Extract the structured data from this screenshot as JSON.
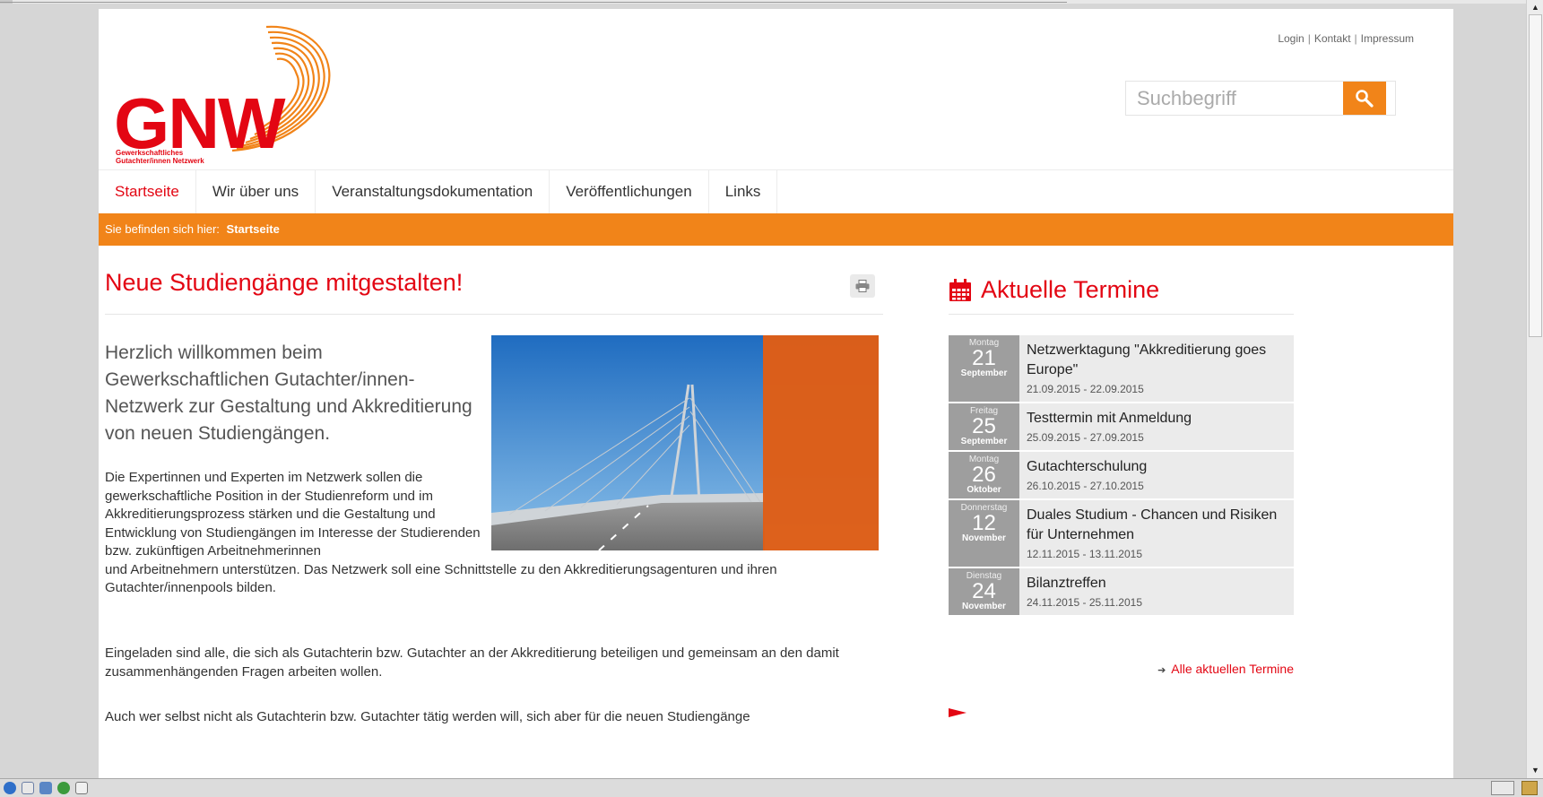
{
  "header": {
    "logo_text": "GNW",
    "logo_subtitle_line1": "Gewerkschaftliches",
    "logo_subtitle_line2": "Gutachter/innen Netzwerk",
    "utility_links": [
      "Login",
      "Kontakt",
      "Impressum"
    ],
    "search_placeholder": "Suchbegriff"
  },
  "nav": {
    "items": [
      "Startseite",
      "Wir über uns",
      "Veranstaltungsdokumentation",
      "Veröffentlichungen",
      "Links"
    ],
    "active": "Startseite"
  },
  "breadcrumb": {
    "prefix": "Sie befinden sich hier:",
    "current": "Startseite"
  },
  "main": {
    "title": "Neue Studiengänge mitgestalten!",
    "lead": "Herzlich willkommen beim Gewerkschaftlichen Gutachter/innen-Netzwerk zur Gestaltung und Akkreditierung von neuen Studiengängen.",
    "para1_a": "Die Expertinnen und Experten im Netzwerk sollen die gewerkschaftliche Position in der Studienreform und im Akkreditierungsprozess stärken und die Gestaltung und Entwicklung von Studiengängen im Interesse der Studierenden bzw. zukünftigen Arbeitnehmerinnen",
    "para1_b": "und Arbeitnehmern unterstützen. Das Netzwerk soll eine Schnittstelle zu den Akkreditierungsagenturen und ihren Gutachter/innenpools bilden.",
    "para2": "Eingeladen sind alle, die sich als Gutachterin bzw. Gutachter an der Akkreditierung beteiligen und gemeinsam an den damit zusammenhängenden Fragen arbeiten wollen.",
    "para3": "Auch wer selbst nicht als Gutachterin bzw. Gutachter tätig werden will, sich aber für die neuen Studiengänge"
  },
  "sidebar": {
    "title": "Aktuelle Termine",
    "events": [
      {
        "weekday": "Montag",
        "day": "21",
        "month": "September",
        "title": "Netzwerktagung \"Akkreditierung goes Europe\"",
        "range": "21.09.2015 - 22.09.2015"
      },
      {
        "weekday": "Freitag",
        "day": "25",
        "month": "September",
        "title": "Testtermin mit Anmeldung",
        "range": "25.09.2015 - 27.09.2015"
      },
      {
        "weekday": "Montag",
        "day": "26",
        "month": "Oktober",
        "title": "Gutachterschulung",
        "range": "26.10.2015 - 27.10.2015"
      },
      {
        "weekday": "Donnerstag",
        "day": "12",
        "month": "November",
        "title": "Duales Studium - Chancen und Risiken für Unternehmen",
        "range": "12.11.2015 - 13.11.2015"
      },
      {
        "weekday": "Dienstag",
        "day": "24",
        "month": "November",
        "title": "Bilanztreffen",
        "range": "24.11.2015 - 25.11.2015"
      }
    ],
    "all_link": "Alle aktuellen Termine"
  },
  "colors": {
    "brand_red": "#e30613",
    "brand_orange": "#f18419",
    "date_grey": "#9e9e9e"
  }
}
